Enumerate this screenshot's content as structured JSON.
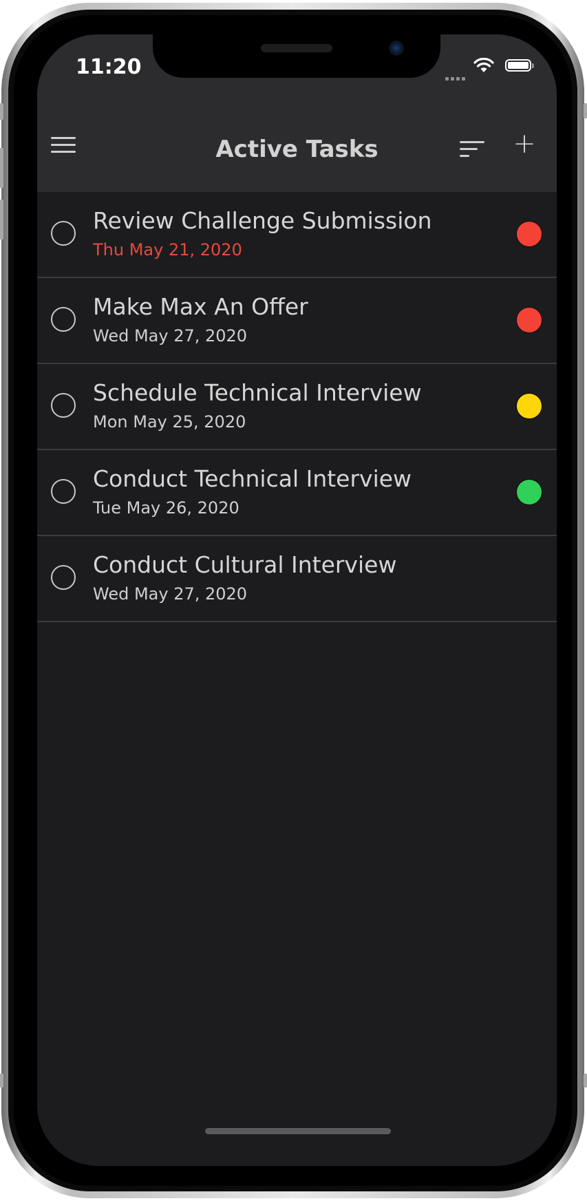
{
  "status_bar": {
    "time": "11:20"
  },
  "navbar": {
    "title": "Active Tasks",
    "menu_icon": "hamburger-menu-icon",
    "sort_icon": "sort-icon",
    "add_icon": "plus-icon"
  },
  "tasks": [
    {
      "title": "Review Challenge Submission",
      "date": "Thu May 21, 2020",
      "overdue": true,
      "priority": "high",
      "priority_color": "#f44336"
    },
    {
      "title": "Make Max An Offer",
      "date": "Wed May 27, 2020",
      "overdue": false,
      "priority": "high",
      "priority_color": "#f44336"
    },
    {
      "title": "Schedule Technical Interview",
      "date": "Mon May 25, 2020",
      "overdue": false,
      "priority": "medium",
      "priority_color": "#ffd60a"
    },
    {
      "title": "Conduct Technical Interview",
      "date": "Tue May 26, 2020",
      "overdue": false,
      "priority": "low",
      "priority_color": "#30d158"
    },
    {
      "title": "Conduct Cultural Interview",
      "date": "Wed May 27, 2020",
      "overdue": false,
      "priority": "none",
      "priority_color": ""
    }
  ],
  "colors": {
    "background": "#1c1c1e",
    "bar": "#2c2c2e",
    "overdue_date": "#e84a3b"
  }
}
